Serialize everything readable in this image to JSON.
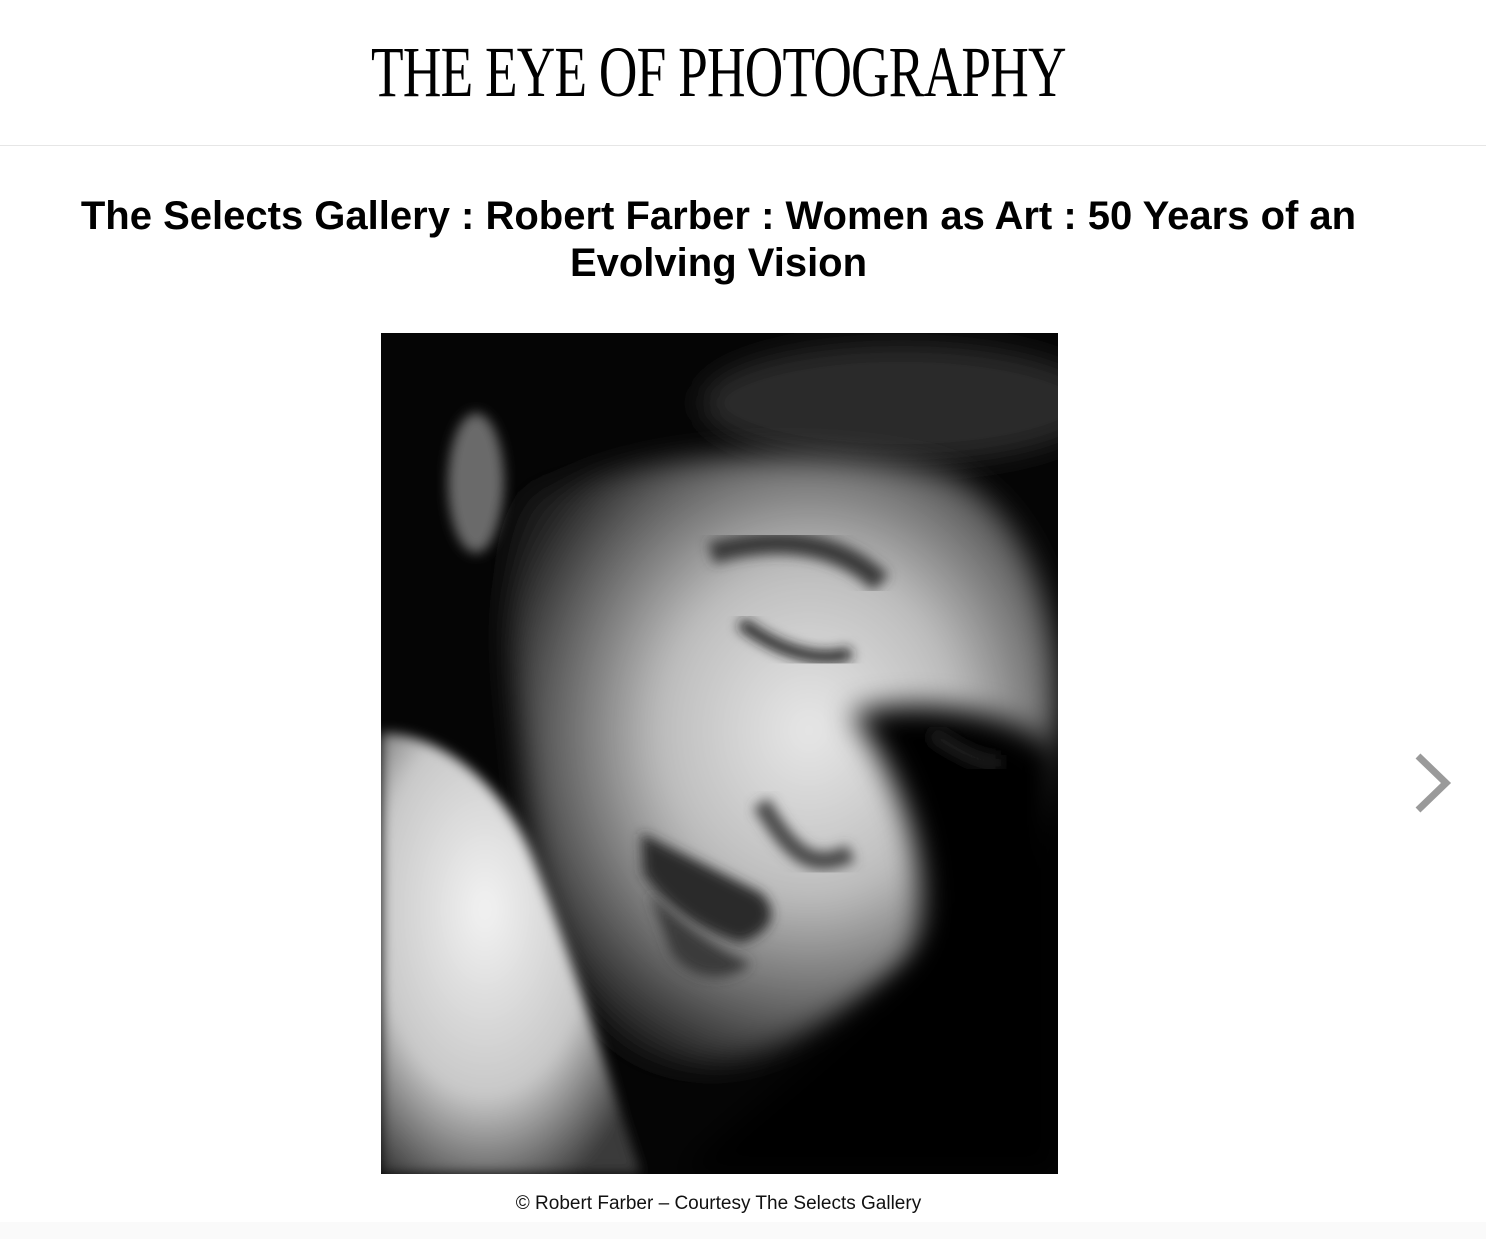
{
  "masthead": {
    "title": "THE EYE OF PHOTOGRAPHY"
  },
  "article": {
    "title": "The Selects Gallery : Robert Farber : Women as Art : 50 Years of an Evolving Vision"
  },
  "slideshow": {
    "caption": "© Robert Farber – Courtesy The Selects Gallery",
    "next_icon": "chevron-right-icon"
  },
  "colors": {
    "background": "#ffffff",
    "text": "#000000",
    "arrow": "#9a9a9a",
    "divider": "#e6e6e6"
  }
}
